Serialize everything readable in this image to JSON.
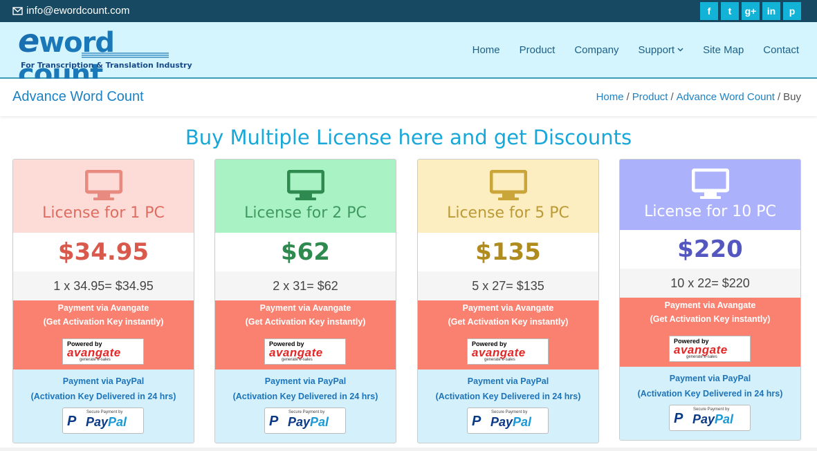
{
  "topbar": {
    "email": "info@ewordcount.com",
    "social": [
      {
        "icon": "facebook-icon",
        "glyph": "f"
      },
      {
        "icon": "twitter-icon",
        "glyph": "t"
      },
      {
        "icon": "google-plus-icon",
        "glyph": "g+"
      },
      {
        "icon": "linkedin-icon",
        "glyph": "in"
      },
      {
        "icon": "pinterest-icon",
        "glyph": "p"
      }
    ]
  },
  "header": {
    "logo_e": "e",
    "logo_text": "word count",
    "tagline": "For Transcription & Translation Industry",
    "nav": [
      "Home",
      "Product",
      "Company",
      "Support",
      "Site Map",
      "Contact"
    ]
  },
  "titlebar": {
    "title": "Advance Word Count",
    "breadcrumb": [
      "Home",
      "Product",
      "Advance Word Count",
      "Buy"
    ],
    "separator": "/"
  },
  "headline": "Buy Multiple License here and get Discounts",
  "payment": {
    "avangate_title": "Payment via Avangate",
    "avangate_sub": "(Get Activation Key instantly)",
    "avangate_powered": "Powered by",
    "avangate_brand": "avangate",
    "avangate_tag": "generate e-sales",
    "paypal_title": "Payment via PayPal",
    "paypal_sub": "(Activation Key Delivered in 24 hrs)",
    "paypal_secure": "Secure Payment by",
    "paypal_pay": "Pay",
    "paypal_pal": "Pal",
    "paypal_p": "P"
  },
  "cards": [
    {
      "title": "License for 1 PC",
      "price": "$34.95",
      "calc": "1 x 34.95= $34.95",
      "top_bg": "#fddcd8",
      "color": "#d9594c",
      "icon_color": "#e98a80"
    },
    {
      "title": "License for 2 PC",
      "price": "$62",
      "calc": "2 x 31= $62",
      "top_bg": "#a9f2c4",
      "color": "#2e8a4e",
      "icon_color": "#2f8a50"
    },
    {
      "title": "License for 5 PC",
      "price": "$135",
      "calc": "5 x 27= $135",
      "top_bg": "#fdeec1",
      "color": "#b08c1e",
      "icon_color": "#c9a53a"
    },
    {
      "title": "License for 10 PC",
      "price": "$220",
      "calc": "10 x 22= $220",
      "top_bg": "#acb1fb",
      "color": "#5557c0",
      "icon_color": "#ffffff",
      "title_color": "#ffffff"
    }
  ],
  "colors": {
    "topbar": "#174a62",
    "header_bg": "#d4f5fd",
    "social": "#12b3d6",
    "headline": "#18a7d9",
    "avangate_bg": "#fa8070",
    "paypal_bg": "#d4f0fb"
  }
}
